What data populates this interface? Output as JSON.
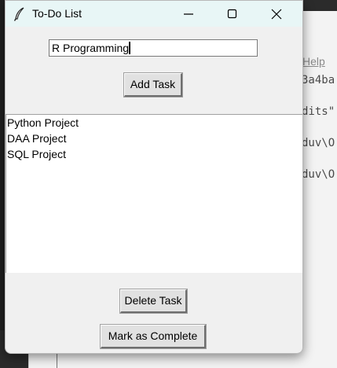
{
  "window": {
    "title": "To-Do List"
  },
  "task_input": {
    "value": "R Programming"
  },
  "buttons": {
    "add": "Add Task",
    "delete": "Delete Task",
    "complete": "Mark as Complete"
  },
  "tasks": [
    "Python Project",
    "DAA Project",
    "SQL Project"
  ],
  "background_editor": {
    "menu_help": "Help",
    "lines": [
      "3a4ba",
      "dits\"",
      "duv\\O",
      "duv\\O"
    ]
  },
  "colors": {
    "titlebar": "#e8f6f6",
    "window_bg": "#f0f0f0",
    "button_bg": "#e1e1e1"
  },
  "icons": {
    "app": "feather-icon",
    "minimize": "minimize-icon",
    "maximize": "maximize-icon",
    "close": "close-icon"
  }
}
